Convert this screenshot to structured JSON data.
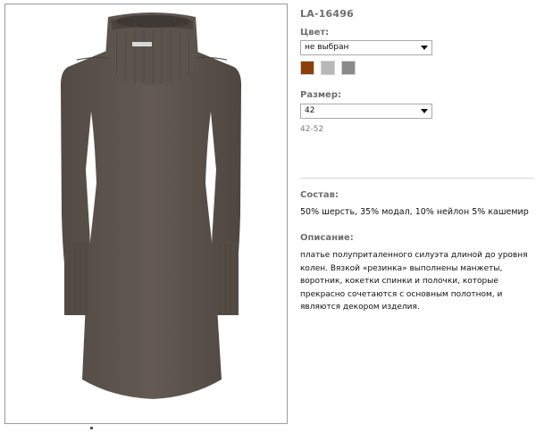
{
  "product": {
    "sku": "LA-16496",
    "color_label": "Цвет:",
    "color_selected": "не выбран",
    "swatches": [
      "#8b3f0a",
      "#b8b8b8",
      "#8a8a8a"
    ],
    "size_label": "Размер:",
    "size_selected": "42",
    "size_range": "42-52",
    "composition_label": "Состав:",
    "composition_text": "50% шерсть, 35% модал, 10% нейлон 5% кашемир",
    "description_label": "Описание:",
    "description_text": "платье полуприталенного силуэта длиной до уровня колен. Вязкой «резинка» выполнены манжеты, воротник, кокетки спинки и полочки, которые прекрасно сочетаются с основным полотном, и являются декором изделия."
  },
  "icons": {
    "select_arrow": "chevron-down-icon"
  }
}
